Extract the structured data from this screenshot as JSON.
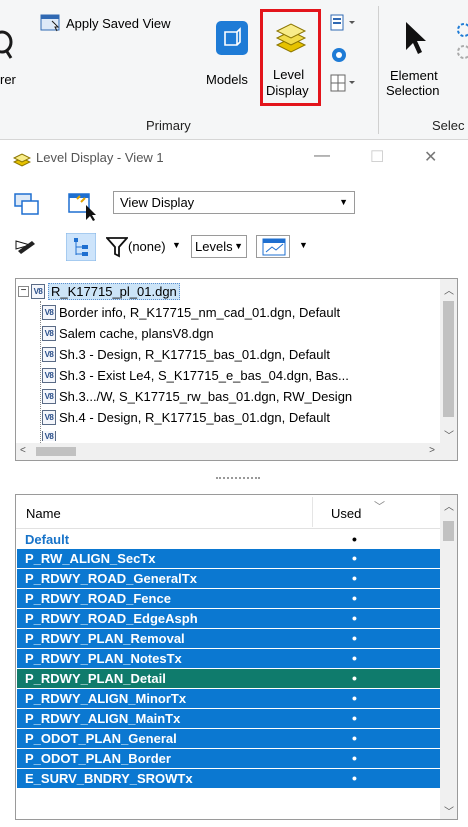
{
  "ribbon": {
    "explorer_partial_label": "rer",
    "apply_saved_view_label": "Apply Saved View",
    "models_label": "Models",
    "level_display_label_line1": "Level",
    "level_display_label_line2": "Display",
    "element_selection_line1": "Element",
    "element_selection_line2": "Selection",
    "group_primary_label": "Primary",
    "group_selection_partial_label": "Selec",
    "highlight_color": "#e3141b"
  },
  "panel": {
    "title": "Level Display - View 1",
    "minimize_glyph": "—",
    "maximize_glyph": "☐",
    "close_glyph": "✕"
  },
  "toolbar": {
    "view_display_value": "View Display",
    "filter_value": "(none)",
    "levels_value": "Levels"
  },
  "tree": {
    "root": "R_K17715_pl_01.dgn",
    "items": [
      "Border info, R_K17715_nm_cad_01.dgn, Default",
      "Salem cache, plansV8.dgn",
      "Sh.3 - Design, R_K17715_bas_01.dgn, Default",
      "Sh.3 - Exist Le4, S_K17715_e_bas_04.dgn, Bas...",
      "Sh.3.../W, S_K17715_rw_bas_01.dgn, RW_Design",
      "Sh.4 - Design, R_K17715_bas_01.dgn, Default"
    ]
  },
  "levels": {
    "header_name": "Name",
    "header_used": "Used",
    "rows": [
      {
        "name": "Default",
        "used": "•"
      },
      {
        "name": "P_RW_ALIGN_SecTx",
        "used": "•"
      },
      {
        "name": "P_RDWY_ROAD_GeneralTx",
        "used": "•"
      },
      {
        "name": "P_RDWY_ROAD_Fence",
        "used": "•"
      },
      {
        "name": "P_RDWY_ROAD_EdgeAsph",
        "used": "•"
      },
      {
        "name": "P_RDWY_PLAN_Removal",
        "used": "•"
      },
      {
        "name": "P_RDWY_PLAN_NotesTx",
        "used": "•"
      },
      {
        "name": "P_RDWY_PLAN_Detail",
        "used": "•"
      },
      {
        "name": "P_RDWY_ALIGN_MinorTx",
        "used": "•"
      },
      {
        "name": "P_RDWY_ALIGN_MainTx",
        "used": "•"
      },
      {
        "name": "P_ODOT_PLAN_General",
        "used": "•"
      },
      {
        "name": "P_ODOT_PLAN_Border",
        "used": "•"
      },
      {
        "name": "E_SURV_BNDRY_SROWTx",
        "used": "•"
      }
    ],
    "selected_color": "#0b78d1",
    "focused_color": "#0f7b6c",
    "default_text_color": "#1773c9"
  }
}
